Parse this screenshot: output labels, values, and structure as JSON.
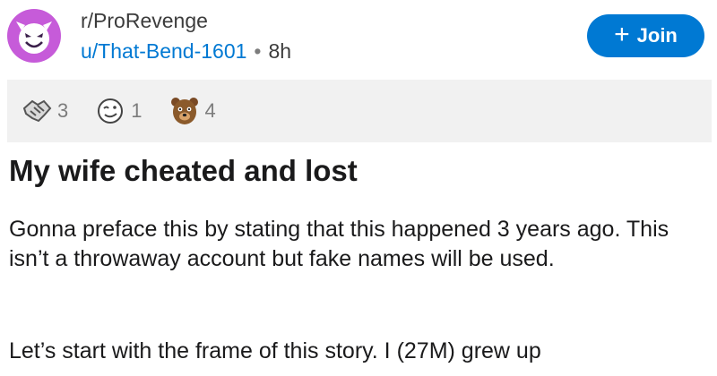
{
  "post": {
    "subreddit": "r/ProRevenge",
    "username": "u/That-Bend-1601",
    "separator": "•",
    "time": "8h",
    "join_label": "Join",
    "join_plus": "+",
    "avatar_icon": "devil-face-icon",
    "title": "My wife cheated and lost",
    "paragraphs": [
      "Gonna preface this by stating that this happened 3 years ago. This isn’t a throwaway account but fake names will be used.",
      "Let’s start with the frame of this story. I (27M) grew up"
    ]
  },
  "awards": [
    {
      "icon": "handshake-award-icon",
      "count": "3"
    },
    {
      "icon": "wink-face-award-icon",
      "count": "1"
    },
    {
      "icon": "bear-award-icon",
      "count": "4"
    }
  ],
  "colors": {
    "accent": "#0079d3",
    "avatar_bg": "#c65bd9",
    "award_bar_bg": "#f1f1f1",
    "text": "#1a1a1b",
    "meta": "#7c7c7c"
  }
}
